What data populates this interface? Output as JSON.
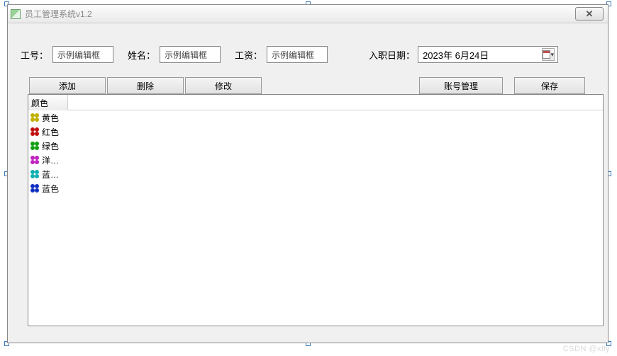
{
  "window": {
    "title": "员工管理系统v1.2"
  },
  "form": {
    "id_label": "工号：",
    "id_value": "示例编辑框",
    "name_label": "姓名：",
    "name_value": "示例编辑框",
    "salary_label": "工资：",
    "salary_value": "示例编辑框",
    "date_label": "入职日期：",
    "date_value": "2023年  6月24日"
  },
  "toolbar": {
    "add": "添加",
    "delete": "删除",
    "modify": "修改",
    "account": "账号管理",
    "save": "保存"
  },
  "list": {
    "header": "颜色",
    "rows": [
      {
        "label": "黄色",
        "color": "#c0b000"
      },
      {
        "label": "红色",
        "color": "#c01010"
      },
      {
        "label": "绿色",
        "color": "#10a010"
      },
      {
        "label": "洋…",
        "color": "#c020c0"
      },
      {
        "label": "蓝…",
        "color": "#10b0b0"
      },
      {
        "label": "蓝色",
        "color": "#1030c0"
      }
    ]
  },
  "watermark": "CSDN @xlly"
}
